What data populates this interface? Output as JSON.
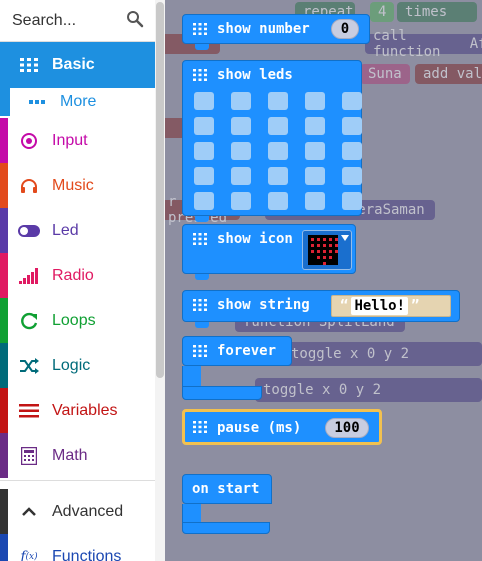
{
  "search": {
    "placeholder": "Search..."
  },
  "categories": [
    {
      "id": "basic",
      "label": "Basic",
      "color": "#1e90e0",
      "icon": "grid-icon"
    },
    {
      "id": "more",
      "label": "More",
      "color": "#1e90e0",
      "icon": "dots-icon"
    },
    {
      "id": "input",
      "label": "Input",
      "color": "#c40aa8",
      "icon": "target-icon"
    },
    {
      "id": "music",
      "label": "Music",
      "color": "#e24a1c",
      "icon": "headphones-icon"
    },
    {
      "id": "led",
      "label": "Led",
      "color": "#5a3aa7",
      "icon": "toggle-icon"
    },
    {
      "id": "radio",
      "label": "Radio",
      "color": "#e01a62",
      "icon": "signal-bars-icon"
    },
    {
      "id": "loops",
      "label": "Loops",
      "color": "#10a033",
      "icon": "refresh-icon"
    },
    {
      "id": "logic",
      "label": "Logic",
      "color": "#006b7a",
      "icon": "shuffle-icon"
    },
    {
      "id": "variables",
      "label": "Variables",
      "color": "#c21414",
      "icon": "lines-icon"
    },
    {
      "id": "math",
      "label": "Math",
      "color": "#6b2c86",
      "icon": "calculator-icon"
    },
    {
      "id": "advanced",
      "label": "Advanced",
      "color": "#333333",
      "icon": "chevron-up-icon"
    },
    {
      "id": "functions",
      "label": "Functions",
      "color": "#1b48b2",
      "icon": "function-icon"
    }
  ],
  "blocks": {
    "show_number": {
      "label": "show number",
      "value": "0"
    },
    "show_leds": {
      "label": "show leds"
    },
    "show_icon": {
      "label": "show icon"
    },
    "show_string": {
      "label": "show string",
      "open_quote": "“",
      "value": "Hello!",
      "close_quote": "”"
    },
    "forever": {
      "label": "forever"
    },
    "pause": {
      "label": "pause (ms)",
      "value": "100"
    },
    "on_start": {
      "label": "on start"
    }
  },
  "background_text": {
    "repeat": "repeat",
    "repeat_count": "4",
    "times": "times",
    "call_function": "call function",
    "call_arg": "Afi",
    "add_val": "add val",
    "sound": "Suna",
    "pressed": "r pressed",
    "function_bera": "function BeraSaman",
    "function_split": "function SplitLand",
    "toggle": "toggle",
    "x": "x",
    "y": "y",
    "toggle_x": "0",
    "toggle_y": "2"
  },
  "colors": {
    "accent": "#1e90ff",
    "workspace_bg": "#8d8ea1",
    "selection": "#f2c14f"
  }
}
